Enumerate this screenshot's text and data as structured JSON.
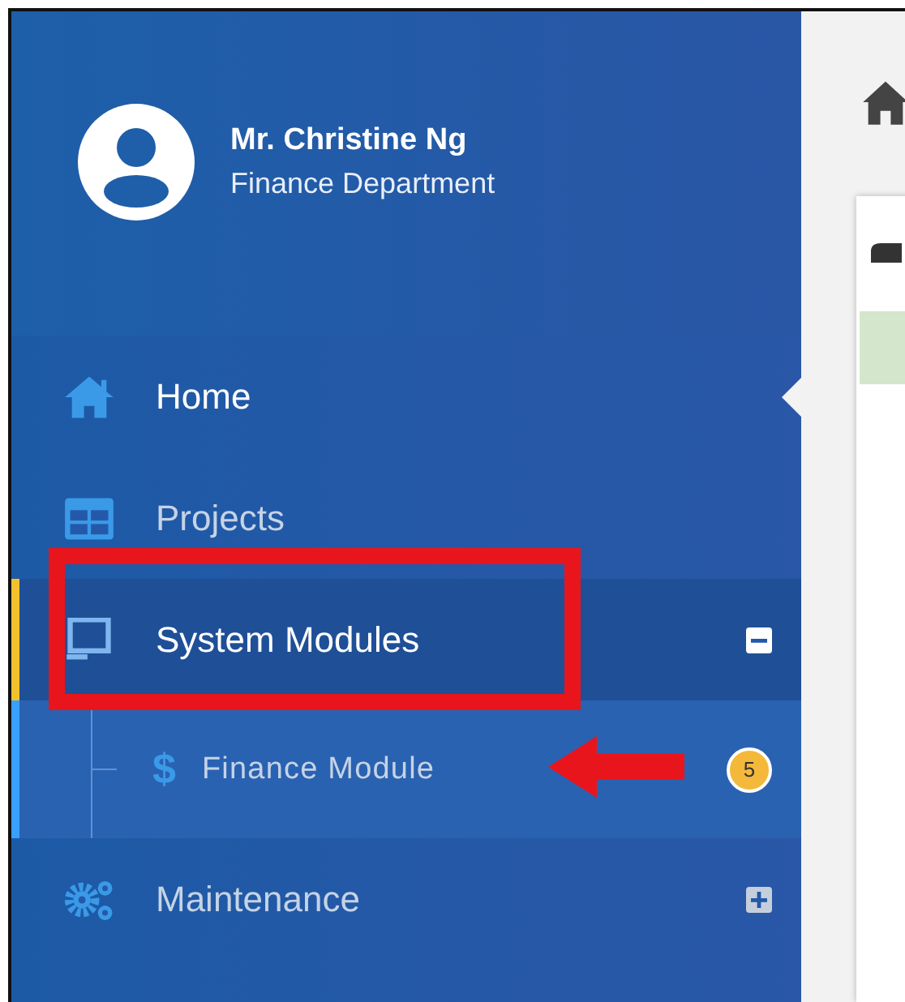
{
  "user": {
    "name": "Mr. Christine Ng",
    "department": "Finance Department"
  },
  "menu": [
    {
      "label": "Home",
      "selected": true
    },
    {
      "label": "Projects",
      "selected": false
    },
    {
      "label": "System Modules",
      "selected": false,
      "expanded": true,
      "children": [
        {
          "label": "Finance Module",
          "icon_glyph": "$",
          "badge": "5",
          "selected": false
        }
      ]
    },
    {
      "label": "Maintenance",
      "selected": false,
      "expanded": false
    }
  ]
}
